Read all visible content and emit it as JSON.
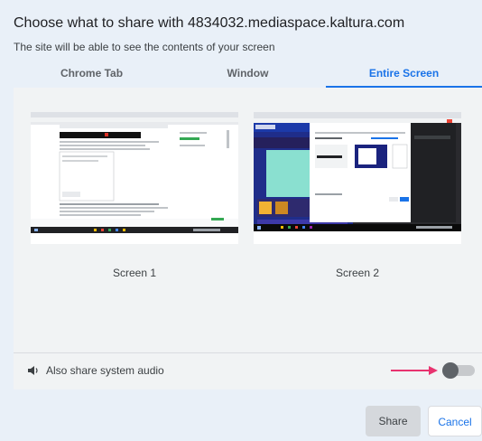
{
  "dialog": {
    "title": "Choose what to share with 4834032.mediaspace.kaltura.com",
    "subtitle": "The site will be able to see the contents of your screen"
  },
  "tabs": [
    {
      "label": "Chrome Tab",
      "active": false
    },
    {
      "label": "Window",
      "active": false
    },
    {
      "label": "Entire Screen",
      "active": true
    }
  ],
  "screens": [
    {
      "label": "Screen 1"
    },
    {
      "label": "Screen 2"
    }
  ],
  "audio": {
    "label": "Also share system audio",
    "icon": "speaker-icon",
    "enabled": false
  },
  "buttons": {
    "share": "Share",
    "cancel": "Cancel"
  },
  "colors": {
    "accent": "#1a73e8",
    "arrow": "#e8336f",
    "background": "#e9f0f8"
  }
}
